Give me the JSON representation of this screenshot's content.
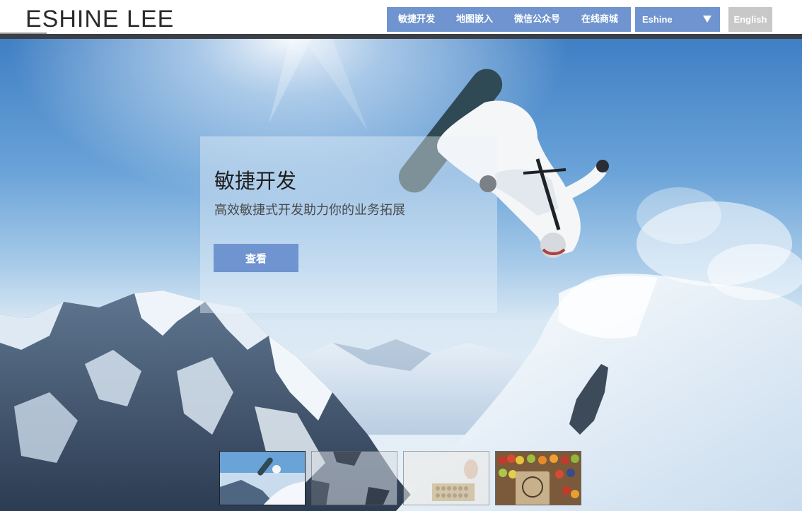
{
  "header": {
    "logo": "ESHINE LEE",
    "nav": [
      {
        "label": "敏捷开发"
      },
      {
        "label": "地图嵌入"
      },
      {
        "label": "微信公众号"
      },
      {
        "label": "在线商城"
      }
    ],
    "select": {
      "value": "Eshine"
    },
    "language_button": "English"
  },
  "hero": {
    "title": "敏捷开发",
    "subtitle": "高效敏捷式开发助力你的业务拓展",
    "button": "查看"
  },
  "thumbnails": [
    {
      "name": "snowboard",
      "active": true
    },
    {
      "name": "abstract-blocks",
      "active": false
    },
    {
      "name": "abacus",
      "active": false
    },
    {
      "name": "fruit-market",
      "active": false
    }
  ],
  "colors": {
    "accent": "#6f94cf",
    "disabled": "#c8c8c8",
    "header_bar": "#3b3f46"
  }
}
